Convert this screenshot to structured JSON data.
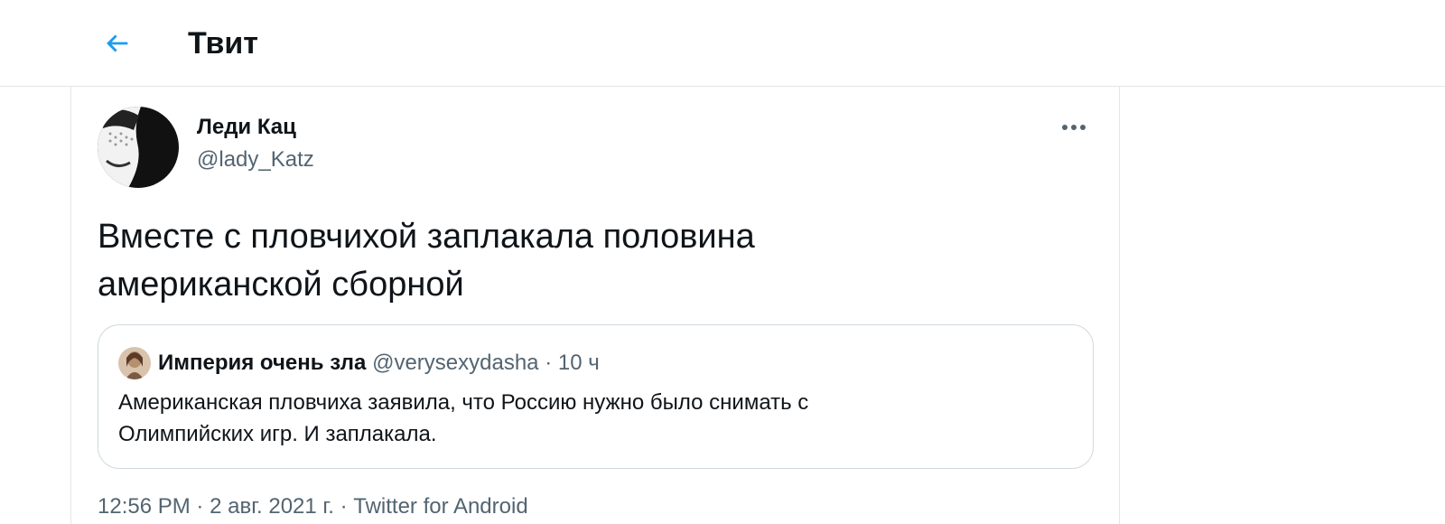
{
  "header": {
    "back_icon": "arrow-left-icon",
    "title": "Твит"
  },
  "tweet": {
    "author": {
      "name": "Леди Кац",
      "handle": "@lady_Katz"
    },
    "more_icon": "more-horizontal-icon",
    "text_line1": "Вместе с пловчихой заплакала половина",
    "text_line2": "американской сборной",
    "quote": {
      "author_name": "Империя очень зла",
      "author_handle": "@verysexydasha",
      "separator": "·",
      "time": "10 ч",
      "text_line1": "Американская пловчиха заявила, что Россию нужно было снимать с",
      "text_line2": "Олимпийских игр. И заплакала."
    },
    "meta": {
      "time": "12:56 PM",
      "separator": "·",
      "date": "2 авг. 2021 г.",
      "source": "Twitter for Android"
    }
  },
  "colors": {
    "accent": "#1d9bf0",
    "text": "#0f1419",
    "secondary_text": "#536471",
    "border": "#cfd9de"
  }
}
